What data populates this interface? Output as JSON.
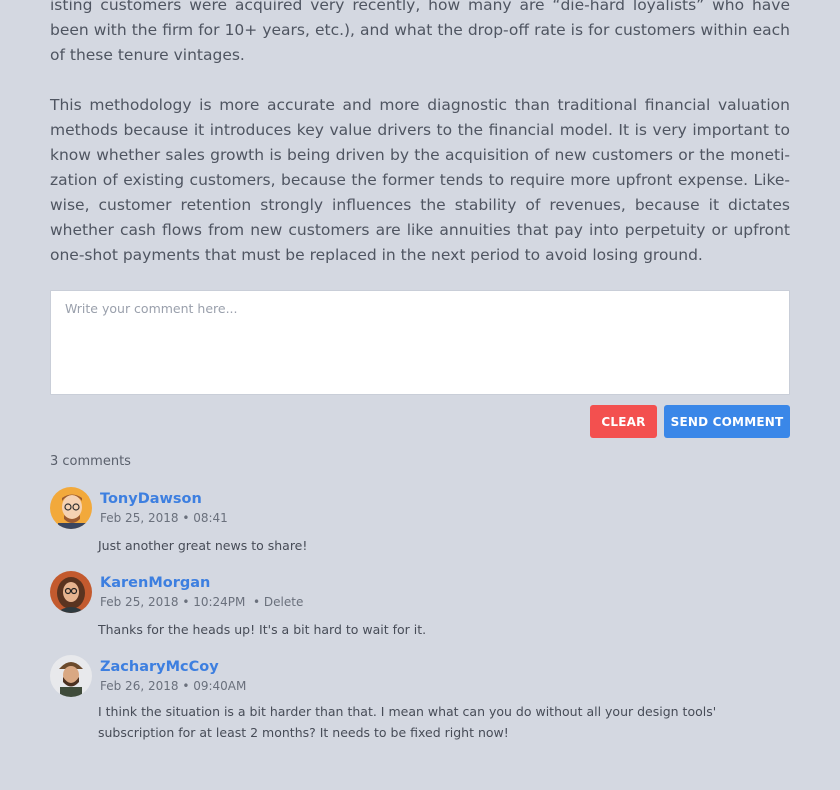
{
  "article": {
    "paragraphs": [
      "isting customers were acquired very recently, how many are “die-hard loyalists” who have been with the firm for 10+ years, etc.), and what the drop-off rate is for customers within each of these tenure vintages.",
      "This methodology is more accurate and more diagnostic than traditional financial valuation methods because it introduces key value drivers to the financial model. It is very important to know whether sales growth is being driven by the acquisition of new customers or the moneti-zation of existing customers, because the former tends to require more upfront expense. Like-wise, customer retention strongly influences the stability of revenues, because it dictates whether cash flows from new customers are like annuities that pay into perpetuity or upfront one-shot payments that must be replaced in the next period to avoid losing ground."
    ]
  },
  "comment_form": {
    "placeholder": "Write your comment here...",
    "value": "",
    "clear_label": "CLEAR",
    "send_label": "SEND COMMENT",
    "clear_color": "#f3504f",
    "send_color": "#3a87e8"
  },
  "comments_count": "3 comments",
  "comments": [
    {
      "name": "TonyDawson",
      "meta": "Feb 25, 2018 • 08:41",
      "delete": "",
      "text": "Just another great news to share!"
    },
    {
      "name": "KarenMorgan",
      "meta": "Feb 25, 2018 • 10:24PM",
      "delete": "• Delete",
      "text": "Thanks for the heads up! It's a bit hard to wait for it."
    },
    {
      "name": "ZacharyMcCoy",
      "meta": "Feb 26, 2018 • 09:40AM",
      "delete": "",
      "text": "I think the situation is a bit harder than that. I mean what can you do without all your design tools' subscription for at least  2 months? It needs to be fixed right now!"
    }
  ],
  "accent_color": "#3d7fe0"
}
